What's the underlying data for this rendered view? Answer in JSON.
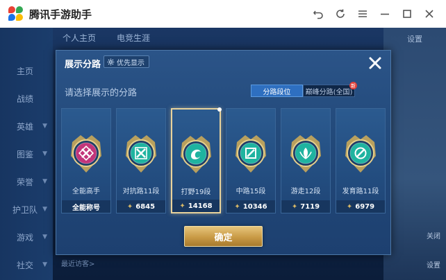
{
  "window": {
    "title": "腾讯手游助手",
    "controls": [
      "back-icon",
      "refresh-icon",
      "menu-icon",
      "minimize-icon",
      "maximize-icon",
      "close-icon"
    ]
  },
  "background": {
    "nav": [
      "主页",
      "战绩",
      "英雄",
      "图鉴",
      "荣誉",
      "护卫队",
      "游戏",
      "社交"
    ],
    "tabs": [
      "个人主页",
      "电竞生涯"
    ],
    "setting": "设置",
    "mic_hint": "最近访客>",
    "right_labels": [
      "关闭",
      "设置"
    ]
  },
  "dialog": {
    "title": "展示分路",
    "priority_button": "优先显示",
    "subtitle": "请选择展示的分路",
    "tabs": {
      "active": "分路段位",
      "inactive": "巅峰分路(全国)"
    },
    "cards": [
      {
        "role": "全能高手",
        "value": "全能称号",
        "show_level_icon": false,
        "color": "#c2357a"
      },
      {
        "role": "对抗路11段",
        "value": "6845",
        "show_level_icon": true,
        "color": "#1fb3a0"
      },
      {
        "role": "打野19段",
        "value": "14168",
        "show_level_icon": true,
        "color": "#1fb3a0",
        "selected": true
      },
      {
        "role": "中路15段",
        "value": "10346",
        "show_level_icon": true,
        "color": "#1fb3a0"
      },
      {
        "role": "游走12段",
        "value": "7119",
        "show_level_icon": true,
        "color": "#1fb3a0"
      },
      {
        "role": "发育路11段",
        "value": "6979",
        "show_level_icon": true,
        "color": "#1fb3a0"
      }
    ],
    "confirm": "确定"
  },
  "colors": {
    "accent_gold": "#d8b866",
    "dialog_bg": "#234a7b",
    "emblem_teal": "#1fb3a0",
    "emblem_magenta": "#c2357a"
  }
}
